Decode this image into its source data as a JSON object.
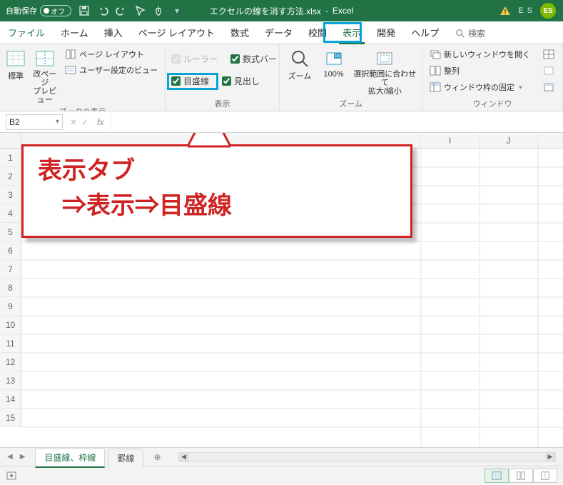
{
  "titlebar": {
    "autosave_label": "自動保存",
    "autosave_state": "オフ",
    "filename": "エクセルの線を消す方法.xlsx",
    "app_name": "Excel",
    "separator": "-",
    "account_initials": "E S",
    "account_badge": "ES"
  },
  "tabs": {
    "file": "ファイル",
    "home": "ホーム",
    "insert": "挿入",
    "pagelayout": "ページ レイアウト",
    "formulas": "数式",
    "data": "データ",
    "review": "校閲",
    "view": "表示",
    "developer": "開発",
    "help": "ヘルプ",
    "search": "検索"
  },
  "ribbon": {
    "workbook_views": {
      "label": "ブックの表示",
      "normal": "標準",
      "page_break_preview": "改ページ\nプレビュー",
      "page_layout": "ページ レイアウト",
      "custom_views": "ユーザー設定のビュー"
    },
    "show": {
      "label": "表示",
      "ruler": "ルーラー",
      "formula_bar": "数式バー",
      "gridlines": "目盛線",
      "headings": "見出し"
    },
    "zoom": {
      "label": "ズーム",
      "zoom": "ズーム",
      "hundred": "100%",
      "selection": "選択範囲に合わせて\n拡大/縮小"
    },
    "window": {
      "label": "ウィンドウ",
      "new_window": "新しいウィンドウを開く",
      "arrange": "整列",
      "freeze": "ウィンドウ枠の固定"
    }
  },
  "formula_bar": {
    "name_box": "B2",
    "fx": "fx"
  },
  "grid": {
    "columns": [
      "I",
      "J"
    ],
    "rows": [
      "1",
      "2",
      "3",
      "4",
      "5",
      "6",
      "7",
      "8",
      "9",
      "10",
      "11",
      "12",
      "13",
      "14",
      "15"
    ],
    "col_widths": {
      "pre_annotation": 560,
      "col_i": 82,
      "col_j": 82
    }
  },
  "annotation": {
    "line1": "表示タブ",
    "line2": "　⇒表示⇒目盛線"
  },
  "sheet_tabs": {
    "tab1": "目盛線、枠線",
    "tab2": "罫線"
  },
  "status": {}
}
